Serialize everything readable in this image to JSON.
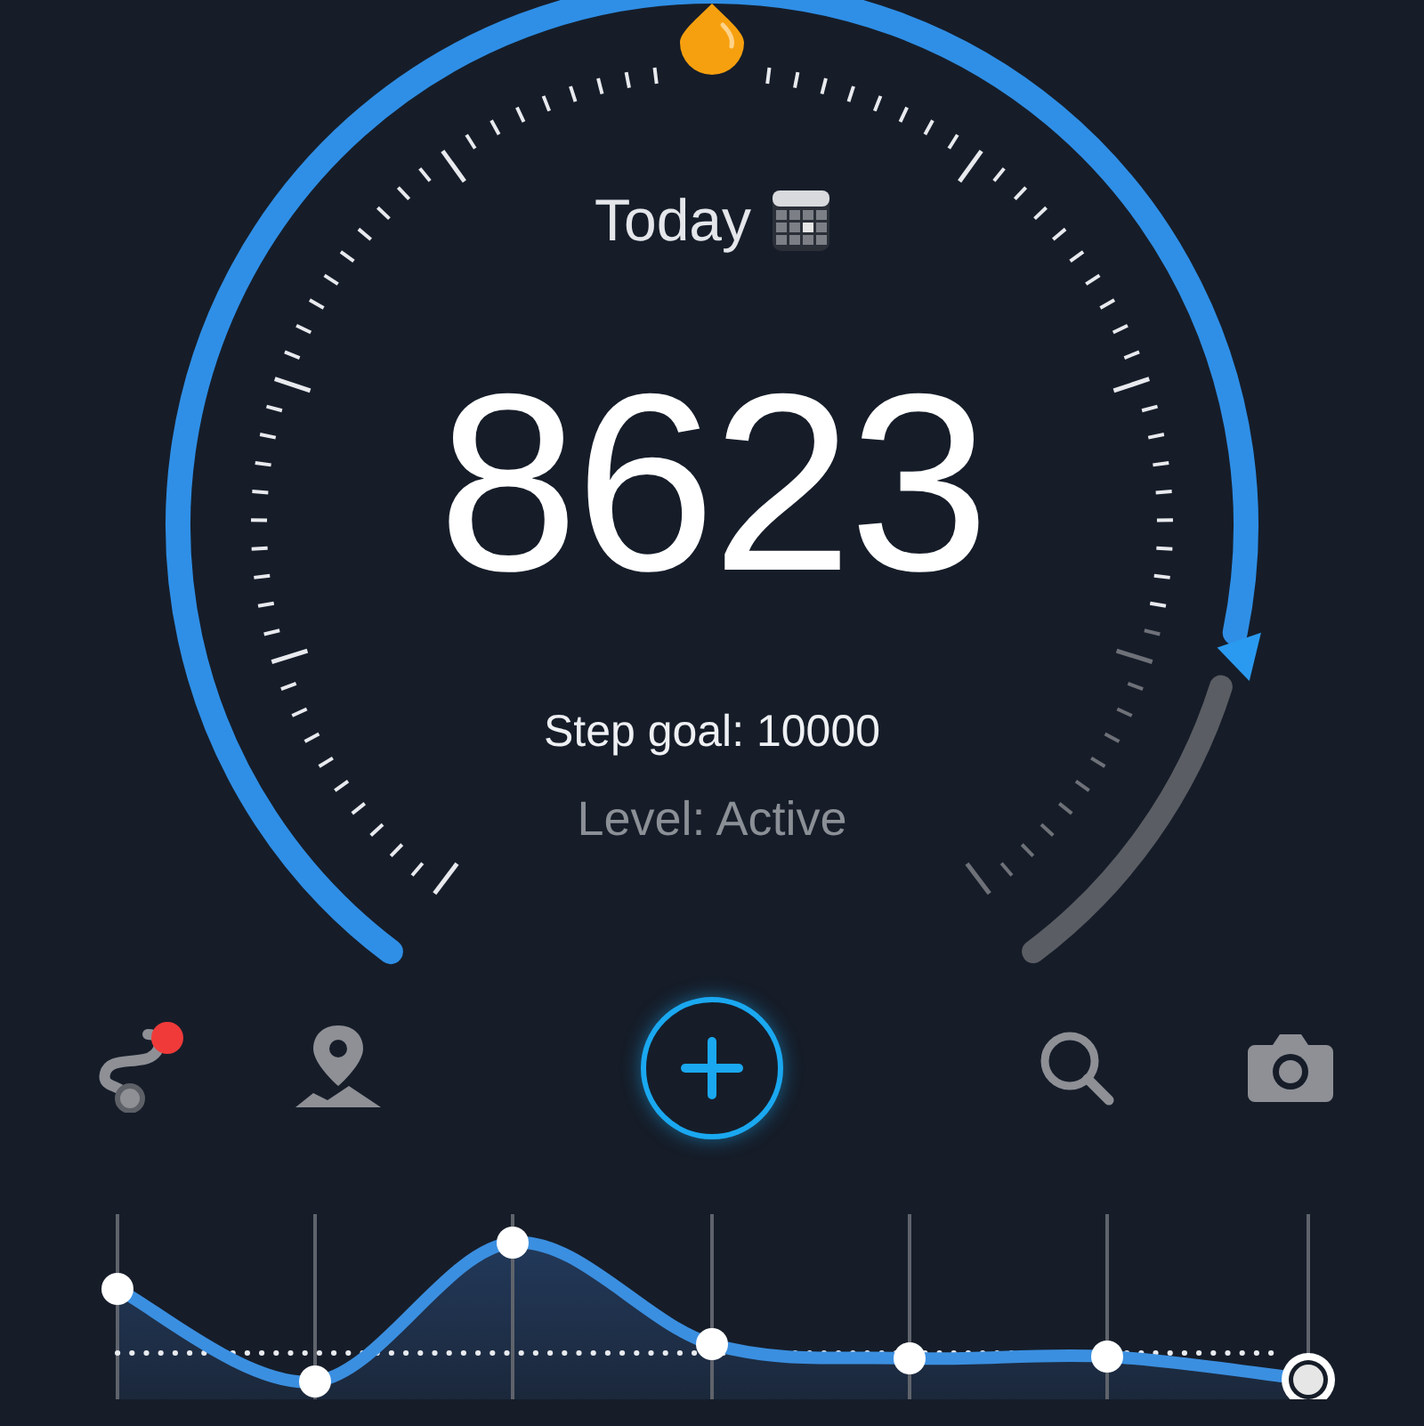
{
  "header": {
    "label": "Today"
  },
  "steps": "8623",
  "goal": "Step goal: 10000",
  "level_text": "Level: Active",
  "toolbar": [
    {
      "kind": "route",
      "notification": true
    },
    {
      "kind": "map"
    },
    {
      "kind": "add"
    },
    {
      "kind": "search"
    },
    {
      "kind": "camera"
    }
  ]
}
